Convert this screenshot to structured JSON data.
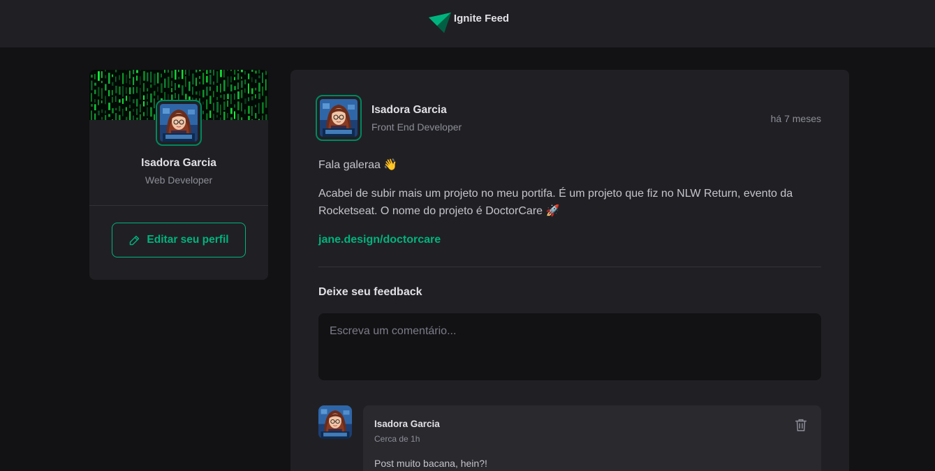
{
  "header": {
    "logo_icon": "ignite-logo-icon",
    "app_name": "Ignite Feed"
  },
  "sidebar": {
    "cover_image": "matrix-code-cover",
    "user": {
      "name": "Isadora Garcia",
      "role": "Web Developer"
    },
    "edit_button": {
      "icon": "pencil-icon",
      "label": "Editar seu perfil"
    }
  },
  "post": {
    "author": {
      "name": "Isadora Garcia",
      "role": "Front End Developer"
    },
    "time": "há 7 meses",
    "content": {
      "greeting": "Fala galeraa 👋",
      "body": "Acabei de subir mais um projeto no meu portifa. É um projeto que fiz no NLW Return, evento da Rocketseat. O nome do projeto é DoctorCare 🚀",
      "link": "jane.design/doctorcare"
    },
    "feedback": {
      "title": "Deixe seu feedback",
      "placeholder": "Escreva um comentário..."
    }
  },
  "comments": [
    {
      "author": "Isadora Garcia",
      "time": "Cerca de 1h",
      "text": "Post muito bacana, hein?!",
      "delete_icon": "trash-icon"
    }
  ],
  "colors": {
    "background": "#121214",
    "surface": "#202024",
    "comment_surface": "#29292e",
    "accent": "#00b37e",
    "accent_dark": "#00875f",
    "text_primary": "#e1e1e6",
    "text_secondary": "#8d8d99"
  }
}
